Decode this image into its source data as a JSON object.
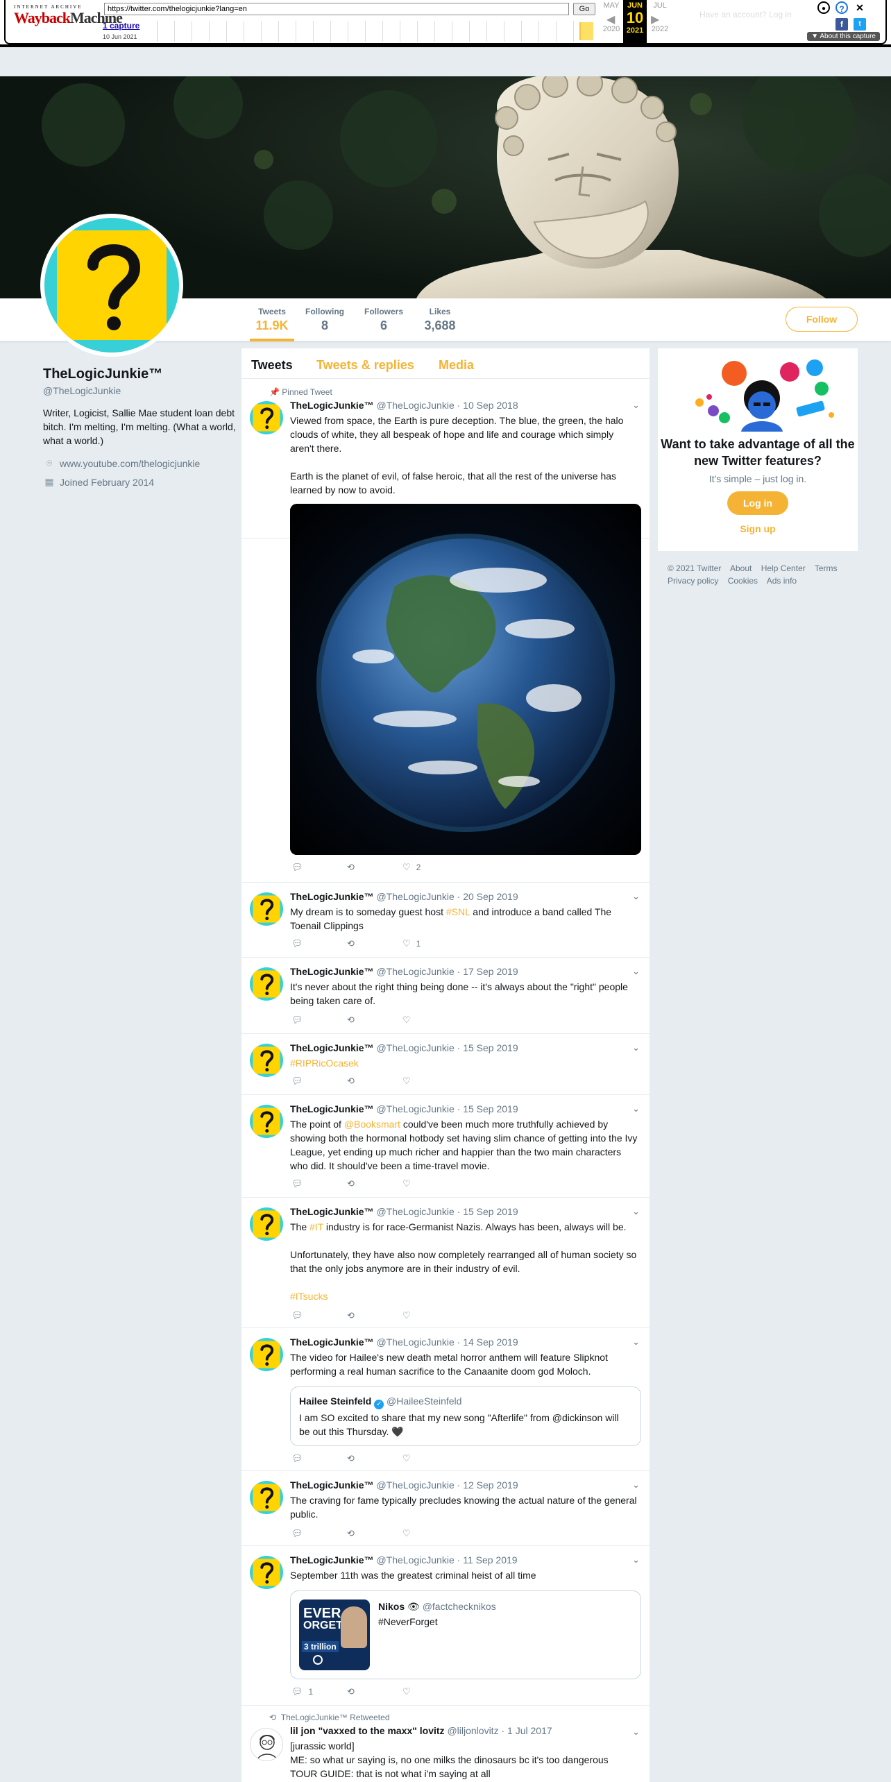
{
  "wayback": {
    "logo_top": "INTERNET ARCHIVE",
    "logo_main_a": "Wayback",
    "logo_main_b": "Machine",
    "url": "https://twitter.com/thelogicjunkie?lang=en",
    "go": "Go",
    "captures": "1 capture",
    "capture_date": "10 Jun 2021",
    "prev_month": "MAY",
    "cur_month": "JUN",
    "next_month": "JUL",
    "cur_day": "10",
    "prev_year": "2020",
    "cur_year": "2021",
    "next_year": "2022",
    "ghost_text": "Have an account? Log in",
    "about": "About this capture"
  },
  "nav": {
    "stats": [
      {
        "label": "Tweets",
        "value": "11.9K"
      },
      {
        "label": "Following",
        "value": "8"
      },
      {
        "label": "Followers",
        "value": "6"
      },
      {
        "label": "Likes",
        "value": "3,688"
      }
    ],
    "follow": "Follow"
  },
  "profile": {
    "name": "TheLogicJunkie™",
    "handle": "@TheLogicJunkie",
    "bio": "Writer, Logicist, Sallie Mae student loan debt bitch. I'm melting, I'm melting. (What a world, what a world.)",
    "website": "www.youtube.com/thelogicjunkie",
    "joined": "Joined February 2014"
  },
  "tabs": [
    "Tweets",
    "Tweets & replies",
    "Media"
  ],
  "tweets": [
    {
      "pinned": "Pinned Tweet",
      "name": "TheLogicJunkie™",
      "handle": "@TheLogicJunkie",
      "date": "10 Sep 2018",
      "text1": "Viewed from space, the Earth is pure deception. The blue, the green, the halo clouds of white, they all bespeak of hope and life and courage which simply aren't there.",
      "text2": "Earth is the planet of evil, of false heroic, that all the rest of the universe has learned by now to avoid.",
      "likes": "2"
    },
    {
      "name": "TheLogicJunkie™",
      "handle": "@TheLogicJunkie",
      "date": "20 Sep 2019",
      "pre": "My dream is to someday guest host ",
      "tag": "#SNL",
      "post": " and introduce a band called The Toenail Clippings",
      "likes": "1"
    },
    {
      "name": "TheLogicJunkie™",
      "handle": "@TheLogicJunkie",
      "date": "17 Sep 2019",
      "text": "It's never about the right thing being done -- it's always about the \"right\" people being taken care of."
    },
    {
      "name": "TheLogicJunkie™",
      "handle": "@TheLogicJunkie",
      "date": "15 Sep 2019",
      "tag": "#RIPRicOcasek"
    },
    {
      "name": "TheLogicJunkie™",
      "handle": "@TheLogicJunkie",
      "date": "15 Sep 2019",
      "pre": "The point of ",
      "tag": "@Booksmart",
      "post": " could've been much more truthfully achieved by showing both the hormonal hotbody set having slim chance of getting into the Ivy League, yet ending up much richer and happier than the two main characters who did.  It should've been a time-travel movie."
    },
    {
      "name": "TheLogicJunkie™",
      "handle": "@TheLogicJunkie",
      "date": "15 Sep 2019",
      "pre": "The ",
      "tag": "#IT",
      "post": " industry is for race-Germanist Nazis.  Always has been, always will be.",
      "text2": "Unfortunately, they have also now completely rearranged all of human society so that the only jobs anymore are in their industry of evil.",
      "tag2": "#ITsucks"
    },
    {
      "name": "TheLogicJunkie™",
      "handle": "@TheLogicJunkie",
      "date": "14 Sep 2019",
      "text": "The video for Hailee's new death metal horror anthem will feature Slipknot performing a real human sacrifice to the Canaanite doom god Moloch.",
      "quote_name": "Hailee Steinfeld",
      "quote_handle": "@HaileeSteinfeld",
      "quote_text": "I am SO excited to share that my new song \"Afterlife\" from @dickinson will be out this Thursday. 🖤"
    },
    {
      "name": "TheLogicJunkie™",
      "handle": "@TheLogicJunkie",
      "date": "12 Sep 2019",
      "text": "The craving for fame typically precludes knowing the actual nature of the general public."
    },
    {
      "name": "TheLogicJunkie™",
      "handle": "@TheLogicJunkie",
      "date": "11 Sep 2019",
      "text": "September 11th was the greatest criminal heist of all time",
      "quote_name": "Nikos",
      "quote_emoji": "👁",
      "quote_handle": "@factchecknikos",
      "quote_text": "#NeverForget",
      "thumb_l1": "EVER",
      "thumb_l2": "ORGET",
      "thumb_l3": "3 trillion",
      "replies": "1"
    },
    {
      "retweet": "TheLogicJunkie™ Retweeted",
      "name": "lil jon \"vaxxed to the maxx\" lovitz",
      "handle": "@liljonlovitz",
      "date": "1 Jul 2017",
      "text": "[jurassic world]",
      "text2": "ME: so what ur saying is, no one milks the dinosaurs bc it's too dangerous",
      "text3": "TOUR GUIDE: that is not what i'm saying at all"
    }
  ],
  "signup": {
    "title": "Want to take advantage of all the new Twitter features?",
    "sub": "It's simple – just log in.",
    "login": "Log in",
    "signup": "Sign up"
  },
  "footer": [
    "© 2021 Twitter",
    "About",
    "Help Center",
    "Terms",
    "Privacy policy",
    "Cookies",
    "Ads info"
  ],
  "colors": {
    "accent": "#f5b335",
    "avatar_bg": "#ffd400",
    "avatar_border": "#37d0d6"
  }
}
